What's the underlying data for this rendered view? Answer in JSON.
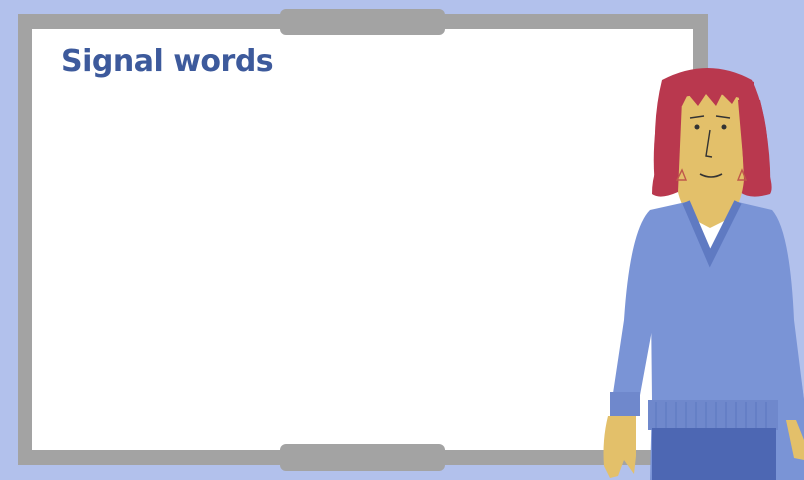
{
  "slide": {
    "title": "Signal words"
  },
  "colors": {
    "background": "#b2c1ec",
    "board_frame": "#a3a3a3",
    "board_surface": "#ffffff",
    "title_text": "#3d5a9c",
    "sweater": "#7a94d6",
    "hair": "#b9384e",
    "skin": "#e3c06a"
  },
  "icons": {
    "presenter": "presenter-character"
  }
}
